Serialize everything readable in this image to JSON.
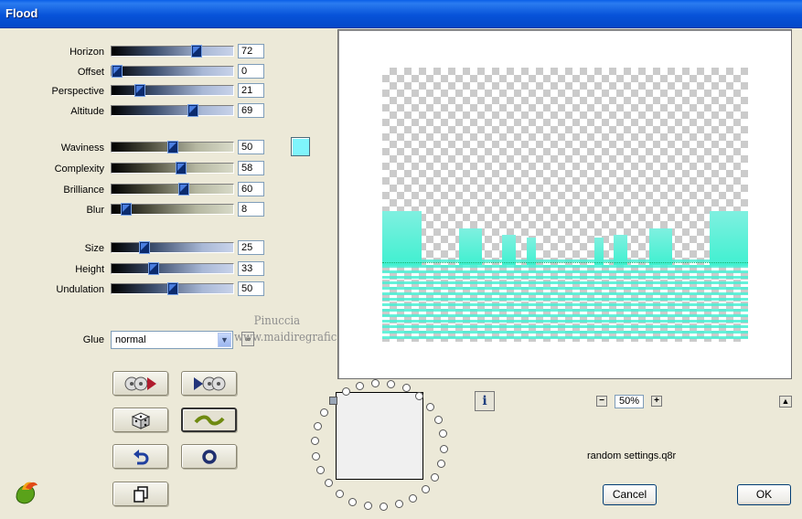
{
  "window": {
    "title": "Flood"
  },
  "sliders": [
    {
      "id": "horizon",
      "label": "Horizon",
      "value": "72",
      "level": 72,
      "style": "blue"
    },
    {
      "id": "offset",
      "label": "Offset",
      "value": "0",
      "level": 0,
      "style": "blue"
    },
    {
      "id": "perspective",
      "label": "Perspective",
      "value": "21",
      "level": 21,
      "style": "blue"
    },
    {
      "id": "altitude",
      "label": "Altitude",
      "value": "69",
      "level": 69,
      "style": "blue"
    },
    {
      "id": "waviness",
      "label": "Waviness",
      "value": "50",
      "level": 50,
      "style": "olive"
    },
    {
      "id": "complexity",
      "label": "Complexity",
      "value": "58",
      "level": 58,
      "style": "olive"
    },
    {
      "id": "brilliance",
      "label": "Brilliance",
      "value": "60",
      "level": 60,
      "style": "olive"
    },
    {
      "id": "blur",
      "label": "Blur",
      "value": "8",
      "level": 8,
      "style": "olive"
    },
    {
      "id": "size",
      "label": "Size",
      "value": "25",
      "level": 25,
      "style": "blue"
    },
    {
      "id": "height",
      "label": "Height",
      "value": "33",
      "level": 33,
      "style": "blue"
    },
    {
      "id": "undulation",
      "label": "Undulation",
      "value": "50",
      "level": 50,
      "style": "blue"
    }
  ],
  "color_swatch": "#7ff4fb",
  "glue": {
    "label": "Glue",
    "value": "normal"
  },
  "watermark": {
    "line1": "Pinuccia",
    "line2": "www.maidiregrafica.eu"
  },
  "zoom": {
    "value": "50%"
  },
  "preset": {
    "name": "random settings.q8r"
  },
  "buttons": {
    "cancel": "Cancel",
    "ok": "OK"
  },
  "colors": {
    "water": "#49f0d4",
    "title_bar": "#0753d9"
  }
}
